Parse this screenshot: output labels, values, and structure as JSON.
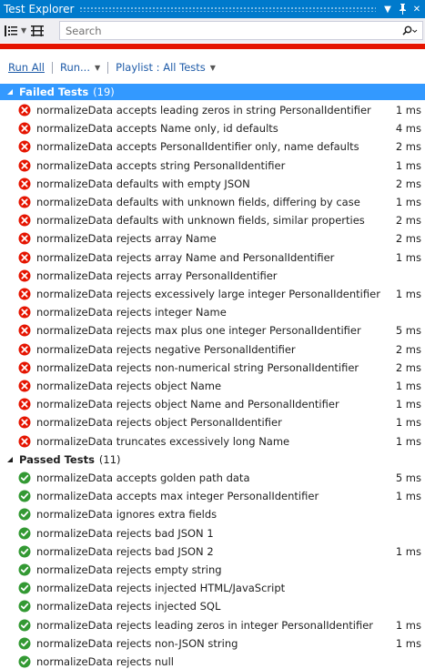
{
  "window": {
    "title": "Test Explorer"
  },
  "toolbar": {
    "group_by_icon": "group-by-icon",
    "playlist_icon": "playlist-icon",
    "search_placeholder": "Search",
    "search_value": ""
  },
  "commands": {
    "run_all": "Run All",
    "run": "Run...",
    "playlist": "Playlist : All Tests"
  },
  "colors": {
    "accent": "#007acc",
    "fail_bar": "#e51400",
    "selection": "#3399ff",
    "fail_icon": "#e51400",
    "pass_icon": "#339933"
  },
  "failed_group": {
    "label": "Failed Tests",
    "count": "(19)",
    "tests": [
      {
        "name": "normalizeData accepts leading zeros in string PersonalIdentifier",
        "duration": "1 ms"
      },
      {
        "name": "normalizeData accepts Name only, id defaults",
        "duration": "4 ms"
      },
      {
        "name": "normalizeData accepts PersonalIdentifier only, name defaults",
        "duration": "2 ms"
      },
      {
        "name": "normalizeData accepts string PersonalIdentifier",
        "duration": "1 ms"
      },
      {
        "name": "normalizeData defaults with empty JSON",
        "duration": "2 ms"
      },
      {
        "name": "normalizeData defaults with unknown fields, differing by case",
        "duration": "1 ms"
      },
      {
        "name": "normalizeData defaults with unknown fields, similar properties",
        "duration": "2 ms"
      },
      {
        "name": "normalizeData rejects array Name",
        "duration": "2 ms"
      },
      {
        "name": "normalizeData rejects array Name and PersonalIdentifier",
        "duration": "1 ms"
      },
      {
        "name": "normalizeData rejects array PersonalIdentifier",
        "duration": ""
      },
      {
        "name": "normalizeData rejects excessively large integer PersonalIdentifier",
        "duration": "1 ms"
      },
      {
        "name": "normalizeData rejects integer Name",
        "duration": ""
      },
      {
        "name": "normalizeData rejects max plus one integer PersonalIdentifier",
        "duration": "5 ms"
      },
      {
        "name": "normalizeData rejects negative PersonalIdentifier",
        "duration": "2 ms"
      },
      {
        "name": "normalizeData rejects non-numerical string PersonalIdentifier",
        "duration": "2 ms"
      },
      {
        "name": "normalizeData rejects object Name",
        "duration": "1 ms"
      },
      {
        "name": "normalizeData rejects object Name and PersonalIdentifier",
        "duration": "1 ms"
      },
      {
        "name": "normalizeData rejects object PersonalIdentifier",
        "duration": "1 ms"
      },
      {
        "name": "normalizeData truncates excessively long Name",
        "duration": "1 ms"
      }
    ]
  },
  "passed_group": {
    "label": "Passed Tests",
    "count": "(11)",
    "tests": [
      {
        "name": "normalizeData accepts golden path data",
        "duration": "5 ms"
      },
      {
        "name": "normalizeData accepts max integer PersonalIdentifier",
        "duration": "1 ms"
      },
      {
        "name": "normalizeData ignores extra fields",
        "duration": ""
      },
      {
        "name": "normalizeData rejects bad JSON 1",
        "duration": ""
      },
      {
        "name": "normalizeData rejects bad JSON 2",
        "duration": "1 ms"
      },
      {
        "name": "normalizeData rejects empty string",
        "duration": ""
      },
      {
        "name": "normalizeData rejects injected HTML/JavaScript",
        "duration": ""
      },
      {
        "name": "normalizeData rejects injected SQL",
        "duration": ""
      },
      {
        "name": "normalizeData rejects leading zeros in integer PersonalIdentifier",
        "duration": "1 ms"
      },
      {
        "name": "normalizeData rejects non-JSON string",
        "duration": "1 ms"
      },
      {
        "name": "normalizeData rejects null",
        "duration": ""
      }
    ]
  }
}
